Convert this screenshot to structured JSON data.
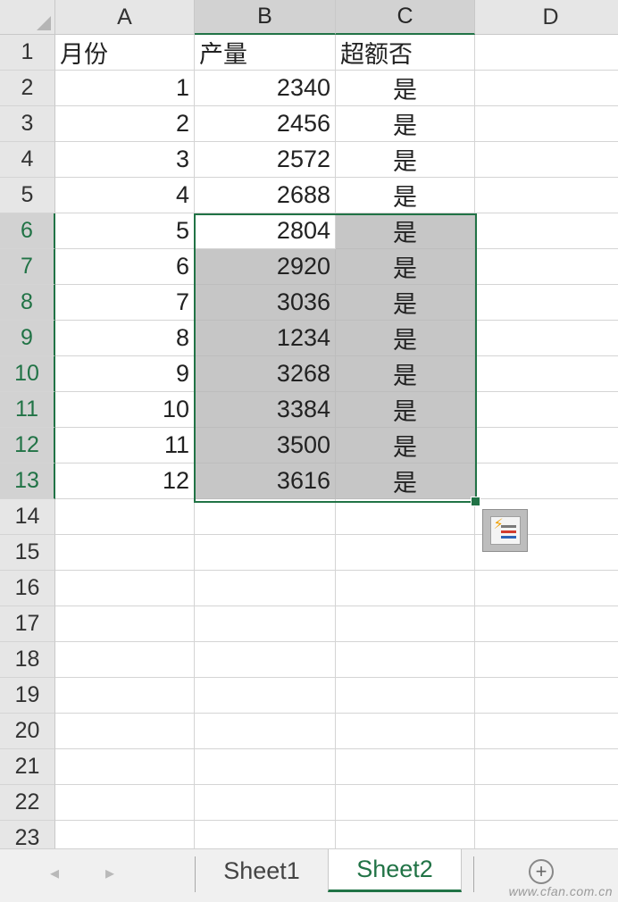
{
  "columns": [
    "A",
    "B",
    "C",
    "D"
  ],
  "selected_columns": [
    "B",
    "C"
  ],
  "row_numbers": [
    "1",
    "2",
    "3",
    "4",
    "5",
    "6",
    "7",
    "8",
    "9",
    "10",
    "11",
    "12",
    "13",
    "14",
    "15",
    "16",
    "17",
    "18",
    "19",
    "20",
    "21",
    "22",
    "23"
  ],
  "selected_rows": [
    "6",
    "7",
    "8",
    "9",
    "10",
    "11",
    "12",
    "13"
  ],
  "header_row": {
    "A": "月份",
    "B": "产量",
    "C": "超额否"
  },
  "data_rows": [
    {
      "month": "1",
      "output": "2340",
      "over": "是"
    },
    {
      "month": "2",
      "output": "2456",
      "over": "是"
    },
    {
      "month": "3",
      "output": "2572",
      "over": "是"
    },
    {
      "month": "4",
      "output": "2688",
      "over": "是"
    },
    {
      "month": "5",
      "output": "2804",
      "over": "是"
    },
    {
      "month": "6",
      "output": "2920",
      "over": "是"
    },
    {
      "month": "7",
      "output": "3036",
      "over": "是"
    },
    {
      "month": "8",
      "output": "1234",
      "over": "是"
    },
    {
      "month": "9",
      "output": "3268",
      "over": "是"
    },
    {
      "month": "10",
      "output": "3384",
      "over": "是"
    },
    {
      "month": "11",
      "output": "3500",
      "over": "是"
    },
    {
      "month": "12",
      "output": "3616",
      "over": "是"
    }
  ],
  "selection": {
    "range": "B6:C13",
    "shade_color": "#c6c6c6",
    "border_color": "#217346"
  },
  "quick_analysis": {
    "icon": "quick-analysis-icon"
  },
  "sheet_tabs": [
    {
      "label": "Sheet1",
      "active": false
    },
    {
      "label": "Sheet2",
      "active": true
    }
  ],
  "tab_nav": {
    "prev": "◂",
    "next": "▸",
    "add": "+"
  },
  "watermark": "www.cfan.com.cn",
  "accent_color": "#217346"
}
